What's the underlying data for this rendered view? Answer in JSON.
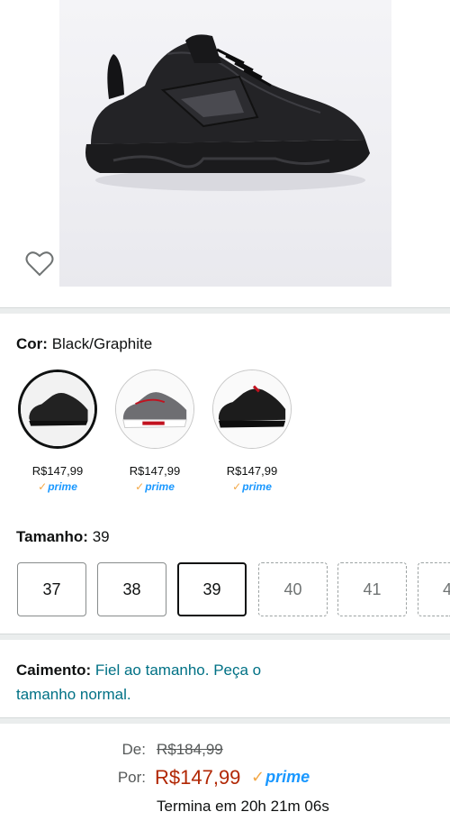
{
  "product": {
    "image_alt": "Black/Graphite sneaker",
    "wishlist_icon": "heart-outline-icon"
  },
  "color": {
    "label": "Cor:",
    "value": "Black/Graphite",
    "swatches": [
      {
        "price": "R$147,99",
        "prime": "prime",
        "selected": true
      },
      {
        "price": "R$147,99",
        "prime": "prime",
        "selected": false
      },
      {
        "price": "R$147,99",
        "prime": "prime",
        "selected": false
      }
    ]
  },
  "size": {
    "label": "Tamanho:",
    "value": "39",
    "options": [
      {
        "label": "37",
        "state": "available"
      },
      {
        "label": "38",
        "state": "available"
      },
      {
        "label": "39",
        "state": "selected"
      },
      {
        "label": "40",
        "state": "unavailable"
      },
      {
        "label": "41",
        "state": "unavailable"
      },
      {
        "label": "4",
        "state": "unavailable"
      }
    ]
  },
  "fit": {
    "label": "Caimento:",
    "link_line1": "Fiel ao tamanho. Peça o",
    "link_line2": "tamanho normal."
  },
  "pricing": {
    "de_label": "De:",
    "old_price": "R$184,99",
    "por_label": "Por:",
    "current_price": "R$147,99",
    "prime": "prime",
    "deal_timer": "Termina em 20h 21m 06s"
  },
  "colors": {
    "price_red": "#b12704",
    "link_teal": "#007185",
    "prime_blue": "#1a98ff",
    "prime_check": "#f3a847"
  }
}
